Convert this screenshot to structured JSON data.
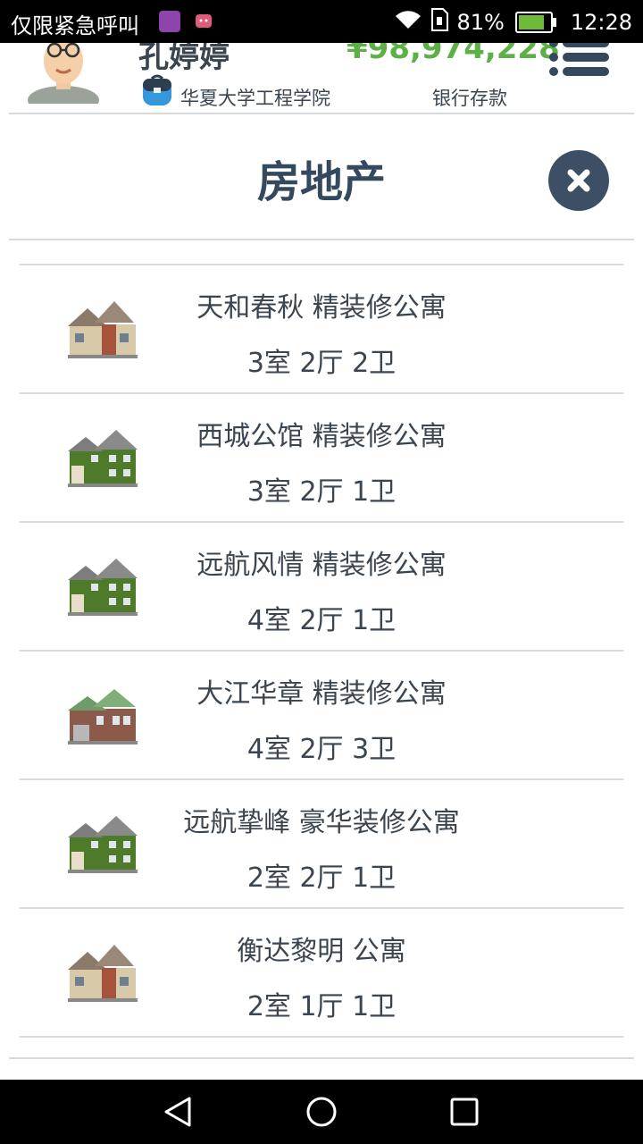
{
  "status_bar": {
    "carrier": "仅限紧急呼叫",
    "battery": "81%",
    "time": "12:28"
  },
  "header": {
    "player_name": "孔婷婷",
    "money": "¥98,974,228",
    "school": "华夏大学工程学院",
    "bank_label": "银行存款"
  },
  "page": {
    "title": "房地产"
  },
  "colors": {
    "money": "#5cb046",
    "title": "#34495e",
    "close_button": "#3d4f64"
  },
  "properties": [
    {
      "name": "天和春秋 精装修公寓",
      "layout": "3室 2厅 2卫",
      "icon": "brown-house-icon"
    },
    {
      "name": "西城公馆 精装修公寓",
      "layout": "3室 2厅 1卫",
      "icon": "green-house-icon"
    },
    {
      "name": "远航风情 精装修公寓",
      "layout": "4室 2厅 1卫",
      "icon": "green-house-icon"
    },
    {
      "name": "大江华章 精装修公寓",
      "layout": "4室 2厅 3卫",
      "icon": "brick-house-icon"
    },
    {
      "name": "远航挚峰 豪华装修公寓",
      "layout": "2室 2厅 1卫",
      "icon": "green-house-icon"
    },
    {
      "name": "衡达黎明 公寓",
      "layout": "2室 1厅 1卫",
      "icon": "brown-house-icon"
    }
  ]
}
